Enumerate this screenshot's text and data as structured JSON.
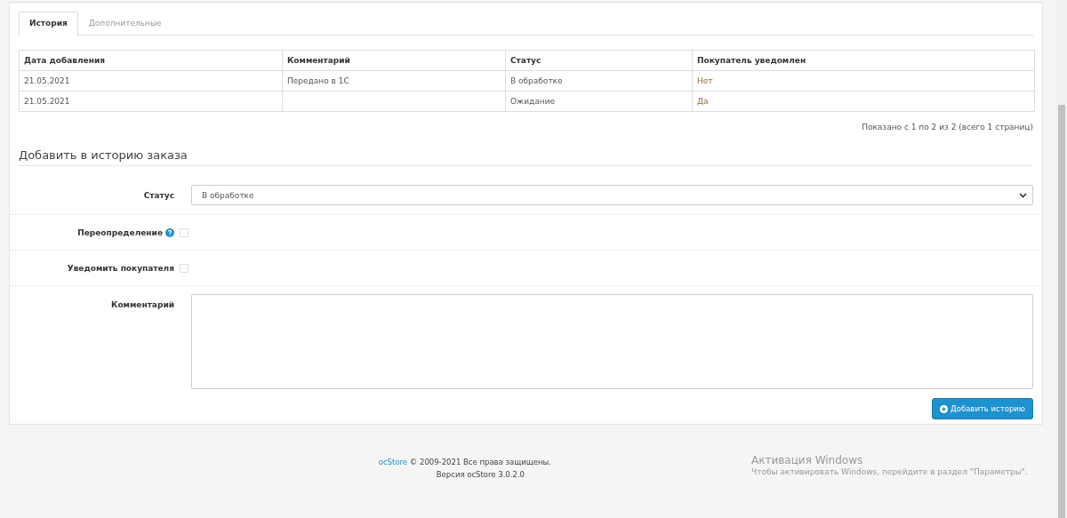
{
  "tabs": [
    {
      "label": "История",
      "selected": true
    },
    {
      "label": "Дополнительные",
      "selected": false
    }
  ],
  "history": {
    "columns": [
      "Дата добавления",
      "Комментарий",
      "Статус",
      "Покупатель уведомлен"
    ],
    "rows": [
      [
        "21.05.2021",
        "Передано в 1С",
        "В обработке",
        "Нет"
      ],
      [
        "21.05.2021",
        "",
        "Ожидание",
        "Да"
      ]
    ],
    "pagination": "Показано с 1 по 2 из 2 (всего 1 страниц)"
  },
  "form": {
    "legend": "Добавить в историю заказа",
    "fields": [
      {
        "kind": "select",
        "label": "Статус",
        "value": "В обработке"
      },
      {
        "kind": "checkbox",
        "label": "Переопределение",
        "help": true,
        "checked": false
      },
      {
        "kind": "checkbox",
        "label": "Уведомить покупателя",
        "help": false,
        "checked": false
      },
      {
        "kind": "textarea",
        "label": "Комментарий"
      }
    ],
    "button": "Добавить историю"
  },
  "footer": {
    "link": "ocStore",
    "copyright": "© 2009-2021 Все права защищены.",
    "version": "Версия ocStore 3.0.2.0"
  },
  "windows_notice": {
    "title": "Активация Windows",
    "text": "Чтобы активировать Windows, перейдите в раздел \"Параметры\"."
  }
}
